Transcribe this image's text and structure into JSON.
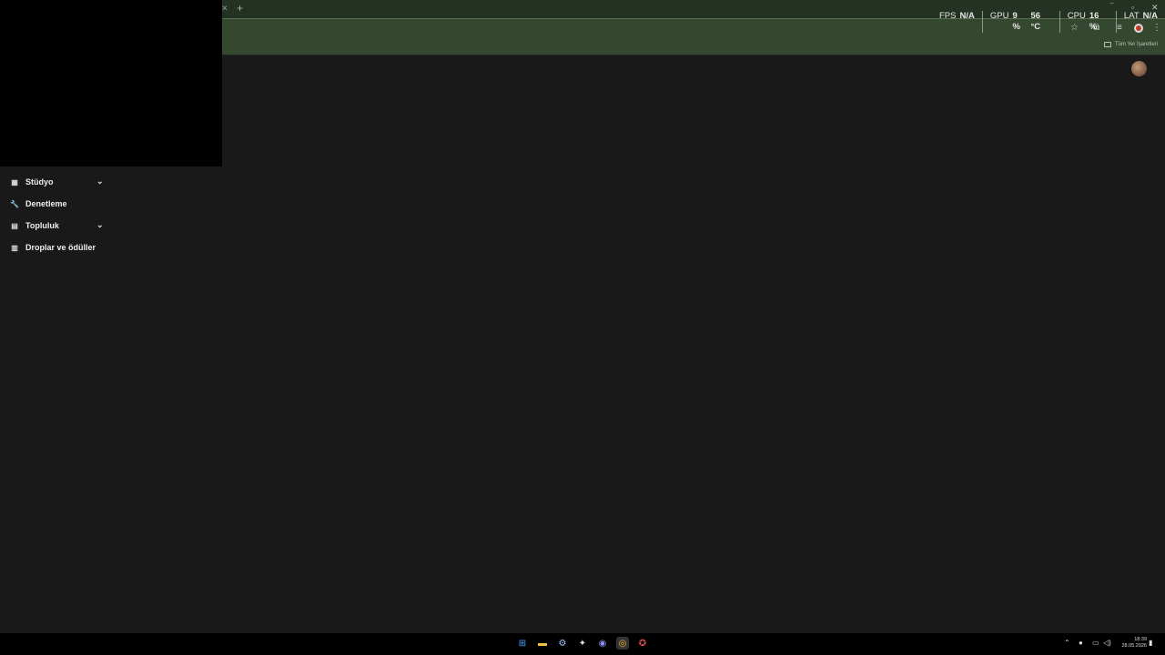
{
  "perf": {
    "fps_label": "FPS",
    "fps_value": "N/A",
    "gpu_label": "GPU",
    "gpu_usage": "9 %",
    "gpu_temp": "56 °C",
    "cpu_label": "CPU",
    "cpu_usage": "16 %",
    "lat_label": "LAT",
    "lat_value": "N/A"
  },
  "browser": {
    "bookmarks_all": "Tüm Yer İşaretleri",
    "accent": "#34472f"
  },
  "sidebar": {
    "items": [
      {
        "label": "Stüdyo",
        "icon": "studio-icon"
      },
      {
        "label": "Denetleme",
        "icon": "wrench-icon"
      },
      {
        "label": "Topluluk",
        "icon": "community-icon"
      },
      {
        "label": "Droplar ve ödüller",
        "icon": "drops-icon"
      }
    ]
  },
  "clock": {
    "time": "18:39",
    "date": "28.05.2026"
  }
}
